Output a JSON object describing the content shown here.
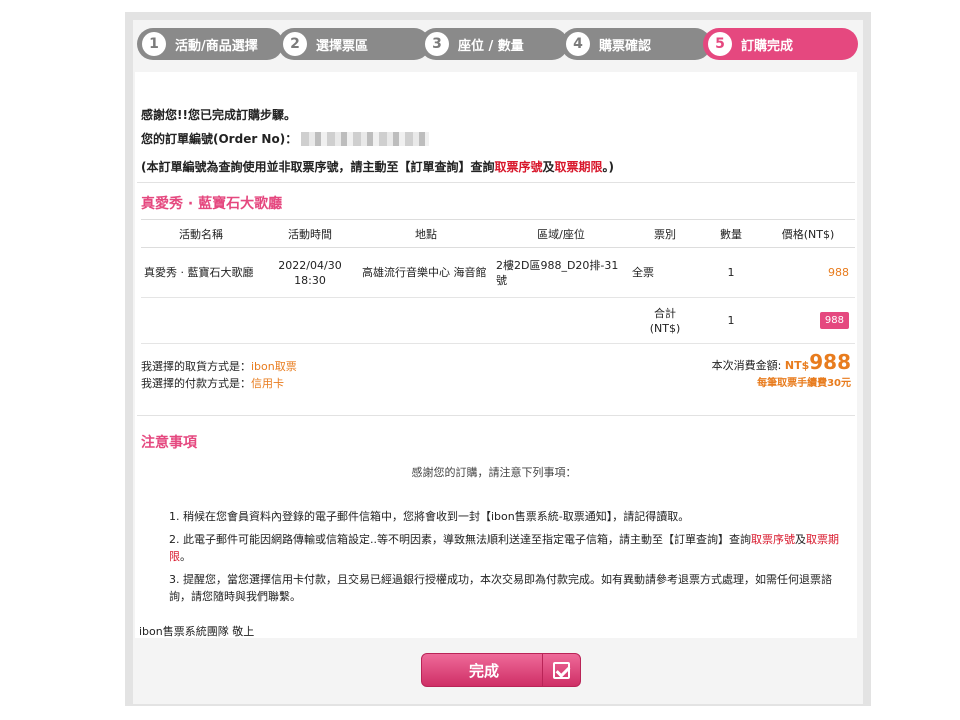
{
  "steps": [
    {
      "num": "1",
      "label": "活動/商品選擇"
    },
    {
      "num": "2",
      "label": "選擇票區"
    },
    {
      "num": "3",
      "label": "座位 / 數量"
    },
    {
      "num": "4",
      "label": "購票確認"
    },
    {
      "num": "5",
      "label": "訂購完成"
    }
  ],
  "thanks": "感謝您!!您已完成訂購步驟。",
  "order_label": "您的訂單編號(Order No)：",
  "note": {
    "prefix": "(本訂單編號為查詢使用並非取票序號，請主動至【訂單查詢】查詢",
    "red1": "取票序號",
    "mid": "及",
    "red2": "取票期限",
    "suffix": "。)"
  },
  "event_title": "真愛秀 · 藍寶石大歌廳",
  "table": {
    "headers": [
      "活動名稱",
      "活動時間",
      "地點",
      "區域/座位",
      "票別",
      "數量",
      "價格(NT$)"
    ],
    "row": {
      "name": "真愛秀 · 藍寶石大歌廳",
      "time": "2022/04/30 18:30",
      "venue": "高雄流行音樂中心 海音館",
      "seat": "2樓2D區988_D20排-31號",
      "type": "全票",
      "qty": "1",
      "price": "988"
    },
    "subtotal_label": "合計\n(NT$)",
    "subtotal_qty": "1",
    "subtotal_price": "988"
  },
  "pickup": {
    "label": "我選擇的取貨方式是：",
    "value": "ibon取票"
  },
  "payment": {
    "label": "我選擇的付款方式是：",
    "value": "信用卡"
  },
  "total": {
    "label": "本次消費金額:",
    "currency": "NT$",
    "amount": "988",
    "fee": "每筆取票手續費30元"
  },
  "notice": {
    "title": "注意事項",
    "intro": "感謝您的訂購，請注意下列事項：",
    "item1": "1. 稍候在您會員資料內登錄的電子郵件信箱中，您將會收到一封【ibon售票系統-取票通知】，請記得讀取。",
    "item2_prefix": "2. 此電子郵件可能因網路傳輸或信箱設定..等不明因素，導致無法順利送達至指定電子信箱，請主動至【訂單查詢】查詢",
    "item2_red1": "取票序號",
    "item2_mid": "及",
    "item2_red2": "取票期限",
    "item2_suffix": "。",
    "item3": "3. 提醒您，當您選擇信用卡付款，且交易已經過銀行授權成功，本次交易即為付款完成。如有異動請參考退票方式處理，如需任何退票諮詢，請您隨時與我們聯繫。"
  },
  "signature": "ibon售票系統團隊 敬上",
  "done_label": "完成",
  "colors": {
    "accent": "#e5487f",
    "inactive_step": "#8a8a8a",
    "price": "#e87c1e",
    "red": "#d8172b"
  }
}
